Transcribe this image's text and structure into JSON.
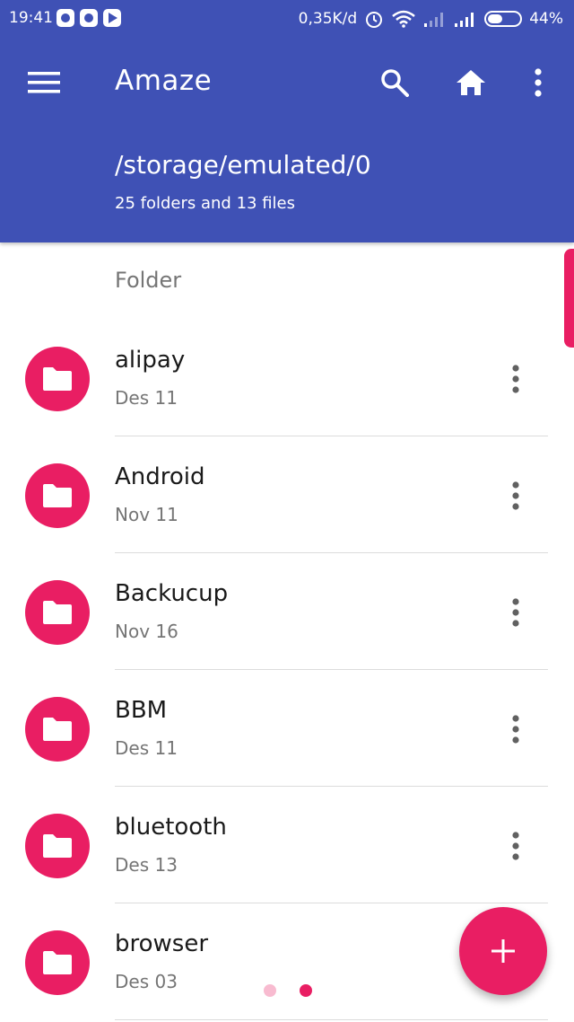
{
  "status_bar": {
    "time": "19:41",
    "net_speed": "0,35K/d",
    "battery": "44%"
  },
  "toolbar": {
    "title": "Amaze",
    "path": "/storage/emulated/0",
    "summary": "25 folders and 13 files"
  },
  "section": {
    "label": "Folder"
  },
  "items": [
    {
      "name": "alipay",
      "date": "Des 11"
    },
    {
      "name": "Android",
      "date": "Nov 11"
    },
    {
      "name": "Backucup",
      "date": "Nov 16"
    },
    {
      "name": "BBM",
      "date": "Des 11"
    },
    {
      "name": "bluetooth",
      "date": "Des 13"
    },
    {
      "name": "browser",
      "date": "Des 03"
    }
  ],
  "colors": {
    "primary": "#3f51b5",
    "accent": "#e91e63"
  },
  "pager": {
    "active_page": 2,
    "total_pages": 2
  }
}
